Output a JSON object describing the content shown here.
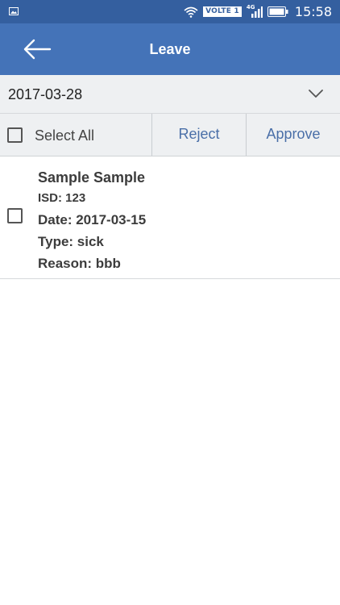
{
  "status_bar": {
    "left_icon": "image-notification-icon",
    "wifi_icon": "wifi-icon",
    "volte_label": "VOLTE 1",
    "network_label": "4G",
    "signal_icon": "signal-icon",
    "battery_icon": "battery-icon",
    "time": "15:58"
  },
  "app_bar": {
    "back_icon": "back-arrow-icon",
    "title": "Leave",
    "color": "#4473b8"
  },
  "date_filter": {
    "value": "2017-03-28",
    "dropdown_icon": "chevron-down-icon"
  },
  "action_bar": {
    "select_all_label": "Select All",
    "select_all_checked": false,
    "reject_label": "Reject",
    "approve_label": "Approve",
    "button_color": "#4a6fa8"
  },
  "leave_requests": [
    {
      "checked": false,
      "name": "Sample Sample",
      "isd": "ISD: 123",
      "date": "Date: 2017-03-15",
      "type": "Type: sick",
      "reason": "Reason: bbb"
    }
  ]
}
